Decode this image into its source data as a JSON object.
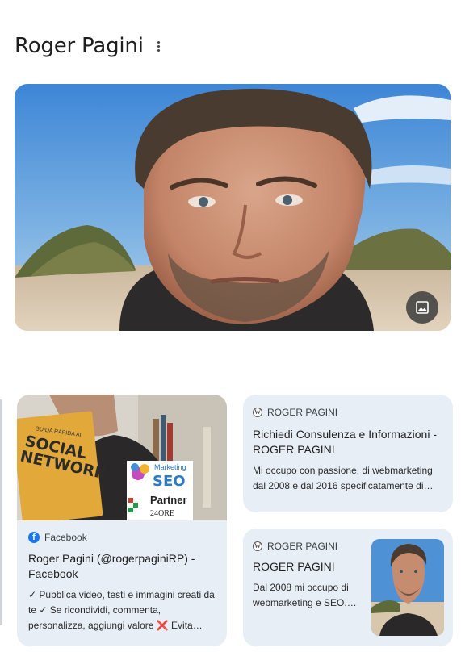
{
  "header": {
    "title": "Roger Pagini",
    "more_icon": "more-vert-icon"
  },
  "hero": {
    "image_alt": "Roger Pagini",
    "badge_icon": "image-icon"
  },
  "cards": [
    {
      "source": "Facebook",
      "source_icon": "facebook-icon",
      "title": "Roger Pagini (@rogerpaginiRP) - Facebook",
      "snippet": "✓ Pubblica video, testi e immagini creati da te ✓ Se ricondividi, commenta, personalizza, aggiungi valore ❌ Evita…",
      "thumb_text": {
        "small": "GUIDA RAPIDA AI",
        "big1": "SOCIAL",
        "big2": "NETWORK",
        "marketing": "Marketing",
        "seo": "SEO",
        "partner": "Partner",
        "sub": "24ORE"
      }
    },
    {
      "source": "ROGER PAGINI",
      "source_icon": "wordpress-icon",
      "title": "Richiedi Consulenza e Informazioni - ROGER PAGINI",
      "snippet": "Mi occupo con passione, di webmarketing dal 2008 e dal 2016 specificatamente di…"
    },
    {
      "source": "ROGER PAGINI",
      "source_icon": "wordpress-icon",
      "title": "ROGER PAGINI",
      "snippet": "Dal 2008 mi occupo di webmarketing e SEO.…"
    }
  ],
  "colors": {
    "card_bg": "#e8eef6",
    "facebook_blue": "#1877f2",
    "title_text": "#1f1f1f"
  }
}
